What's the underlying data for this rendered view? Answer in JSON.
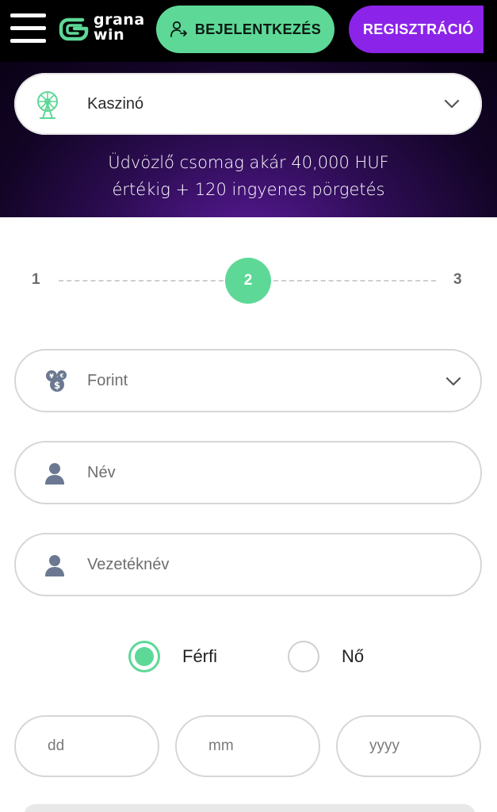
{
  "header": {
    "logo_line1": "grana",
    "logo_line2": "win",
    "login_label": "BEJELENTKEZÉS",
    "register_label": "REGISZTRÁCIÓ",
    "colors": {
      "green": "#5ed897",
      "purple": "#8b24e8",
      "bar": "#000000"
    }
  },
  "hero": {
    "category": {
      "value": "Kaszinó",
      "icon": "ferris-wheel-icon"
    },
    "promo_line1": "Üdvözlő csomag akár 40,000 HUF",
    "promo_line2": "értékig + 120 ingyenes pörgetés"
  },
  "stepper": {
    "steps": [
      "1",
      "2",
      "3"
    ],
    "active": "2"
  },
  "form": {
    "currency": {
      "value": "Forint",
      "icon": "currency-exchange-icon"
    },
    "first_name": {
      "placeholder": "Név",
      "icon": "user-icon"
    },
    "last_name": {
      "placeholder": "Vezetéknév",
      "icon": "user-icon"
    },
    "gender": {
      "options": [
        "Férfi",
        "Nő"
      ],
      "selected": "Férfi"
    },
    "dob": {
      "day_placeholder": "dd",
      "month_placeholder": "mm",
      "year_placeholder": "yyyy"
    }
  }
}
